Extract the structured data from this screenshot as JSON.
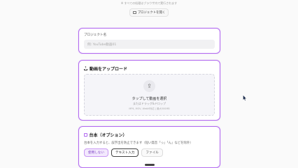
{
  "header": {
    "note": "※ すべての処理はブラウザ内で実行されます",
    "open_project_label": "プロジェクトを開く"
  },
  "project": {
    "label": "プロジェクト名",
    "placeholder": "例: YouTube動画01"
  },
  "upload": {
    "title": "動画をアップロード",
    "drop_title": "タップして動画を選択",
    "drop_sub": "またはドラッグ&ドロップ",
    "formats": "MP4, MOV, WebM対応 | 最大500MB"
  },
  "script": {
    "title": "台本（オプション）",
    "description": "台本を入力すると、誤字出を防止できます（短い発音「っ」「ん」などを除外）",
    "tabs": [
      {
        "label": "使用しない"
      },
      {
        "label": "テキスト入力"
      },
      {
        "label": "ファイル"
      }
    ]
  },
  "colors": {
    "accent": "#b36bf0"
  },
  "icons": {
    "open_project": "folder-icon",
    "upload": "upload-icon",
    "script": "document-icon",
    "cursor": "mouse-pointer-icon"
  }
}
